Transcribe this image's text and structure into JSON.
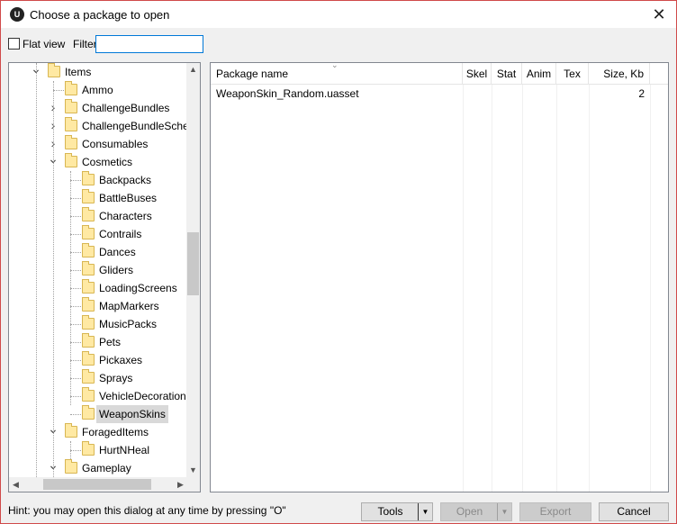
{
  "window": {
    "title": "Choose a package to open",
    "close_glyph": "✕",
    "app_icon_text": "U"
  },
  "filter_bar": {
    "flat_view_label": "Flat view",
    "flat_view_checked": false,
    "filter_label": "Filter:",
    "filter_value": "",
    "filter_placeholder": ""
  },
  "tree": {
    "items": [
      {
        "label": "Items",
        "level": 1,
        "expander": "expanded",
        "selected": false
      },
      {
        "label": "Ammo",
        "level": 2,
        "expander": "none",
        "selected": false
      },
      {
        "label": "ChallengeBundles",
        "level": 2,
        "expander": "collapsed",
        "selected": false
      },
      {
        "label": "ChallengeBundleSchedules",
        "level": 2,
        "expander": "collapsed",
        "selected": false
      },
      {
        "label": "Consumables",
        "level": 2,
        "expander": "collapsed",
        "selected": false
      },
      {
        "label": "Cosmetics",
        "level": 2,
        "expander": "expanded",
        "selected": false
      },
      {
        "label": "Backpacks",
        "level": 3,
        "expander": "none",
        "selected": false
      },
      {
        "label": "BattleBuses",
        "level": 3,
        "expander": "none",
        "selected": false
      },
      {
        "label": "Characters",
        "level": 3,
        "expander": "none",
        "selected": false
      },
      {
        "label": "Contrails",
        "level": 3,
        "expander": "none",
        "selected": false
      },
      {
        "label": "Dances",
        "level": 3,
        "expander": "none",
        "selected": false
      },
      {
        "label": "Gliders",
        "level": 3,
        "expander": "none",
        "selected": false
      },
      {
        "label": "LoadingScreens",
        "level": 3,
        "expander": "none",
        "selected": false
      },
      {
        "label": "MapMarkers",
        "level": 3,
        "expander": "none",
        "selected": false
      },
      {
        "label": "MusicPacks",
        "level": 3,
        "expander": "none",
        "selected": false
      },
      {
        "label": "Pets",
        "level": 3,
        "expander": "none",
        "selected": false
      },
      {
        "label": "Pickaxes",
        "level": 3,
        "expander": "none",
        "selected": false
      },
      {
        "label": "Sprays",
        "level": 3,
        "expander": "none",
        "selected": false
      },
      {
        "label": "VehicleDecorations",
        "level": 3,
        "expander": "none",
        "selected": false
      },
      {
        "label": "WeaponSkins",
        "level": 3,
        "expander": "none",
        "selected": true
      },
      {
        "label": "ForagedItems",
        "level": 2,
        "expander": "expanded",
        "selected": false
      },
      {
        "label": "HurtNHeal",
        "level": 3,
        "expander": "none",
        "selected": false
      },
      {
        "label": "Gameplay",
        "level": 2,
        "expander": "expanded",
        "selected": false
      }
    ]
  },
  "list": {
    "columns": [
      {
        "key": "name",
        "label": "Package name"
      },
      {
        "key": "skel",
        "label": "Skel"
      },
      {
        "key": "stat",
        "label": "Stat"
      },
      {
        "key": "anim",
        "label": "Anim"
      },
      {
        "key": "tex",
        "label": "Tex"
      },
      {
        "key": "size",
        "label": "Size, Kb"
      }
    ],
    "rows": [
      {
        "name": "WeaponSkin_Random.uasset",
        "skel": "",
        "stat": "",
        "anim": "",
        "tex": "",
        "size": "2"
      }
    ]
  },
  "footer": {
    "hint": "Hint: you may open this dialog at any time by pressing \"O\"",
    "tools_label": "Tools",
    "open_label": "Open",
    "export_label": "Export",
    "cancel_label": "Cancel"
  },
  "colors": {
    "title_border": "#d04a4a",
    "selection": "#d9d9d9",
    "folder": "#ffe9a3",
    "focus": "#0078d7"
  }
}
